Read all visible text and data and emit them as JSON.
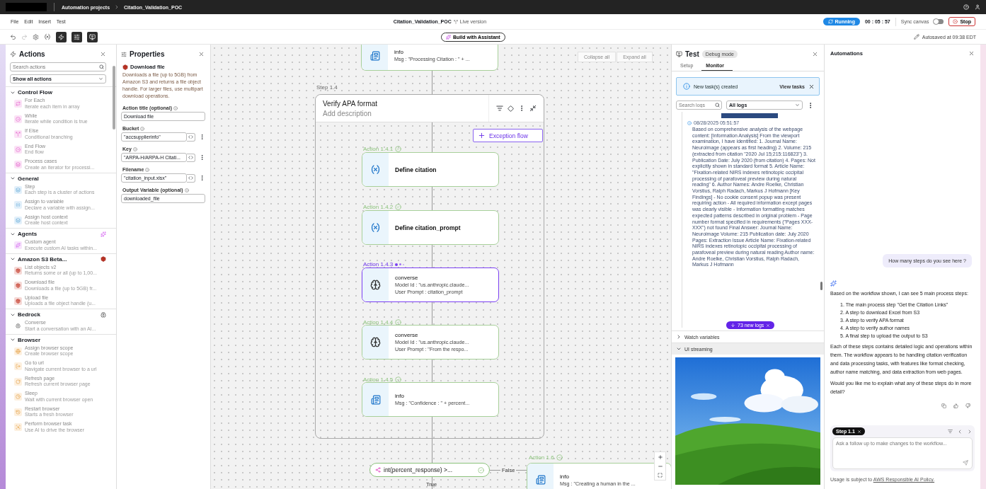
{
  "top_bar": {
    "breadcrumbs": [
      {
        "label": "Automation projects"
      },
      {
        "label": "Citation_Validation_POC"
      }
    ]
  },
  "menu": [
    "File",
    "Edit",
    "Insert",
    "Test"
  ],
  "document": {
    "title": "Citation_Validation_POC",
    "version": "Live version"
  },
  "run": {
    "status": "Running",
    "timer": "00 : 05 : 57",
    "sync_label": "Sync canvas",
    "sync_on": false,
    "stop_label": "Stop"
  },
  "toolbar": {
    "toggles": [
      {
        "kind": "actions",
        "on": true
      },
      {
        "kind": "properties",
        "on": true
      },
      {
        "kind": "test",
        "on": true
      }
    ],
    "assistant_button": "Build with Assistant",
    "autosave": "Autosaved at 09:38 EDT"
  },
  "actions_panel": {
    "title": "Actions",
    "search_placeholder": "Search actions",
    "filter": "Show all actions",
    "sections": [
      {
        "title": "Control Flow",
        "kind": "control",
        "expanded": true,
        "items": [
          {
            "title": "For Each",
            "description": "Iterate each item in array"
          },
          {
            "title": "While",
            "description": "Iterate while condition is true"
          },
          {
            "title": "If Else",
            "description": "Conditional branching"
          },
          {
            "title": "End Flow",
            "description": "End flow"
          },
          {
            "title": "Process cases",
            "description": "Create an iterator for processi..."
          }
        ]
      },
      {
        "title": "General",
        "kind": "general",
        "expanded": true,
        "items": [
          {
            "title": "Step",
            "description": "Each step is a cluster of actions"
          },
          {
            "title": "Assign to variable",
            "description": "Declare a variable with assign..."
          },
          {
            "title": "Assign host context",
            "description": "Create host context"
          }
        ]
      },
      {
        "title": "Agents",
        "kind": "agents",
        "expanded": true,
        "items": [
          {
            "title": "Custom agent",
            "description": "Execute custom AI tasks within..."
          }
        ]
      },
      {
        "title": "Amazon S3 Beta...",
        "kind": "s3",
        "expanded": true,
        "items": [
          {
            "title": "List objects v2",
            "description": "Returns some or all (up to 1,00..."
          },
          {
            "title": "Download file",
            "description": "Downloads a file (up to 5GB) fr..."
          },
          {
            "title": "Upload file",
            "description": "Uploads a file object handle (u..."
          }
        ]
      },
      {
        "title": "Bedrock",
        "kind": "bedrock",
        "expanded": true,
        "items": [
          {
            "title": "Converse",
            "description": "Start a conversation with an AI..."
          }
        ]
      },
      {
        "title": "Browser",
        "kind": "browser",
        "expanded": true,
        "items": [
          {
            "title": "Assign browser scope",
            "description": "Create browser scope"
          },
          {
            "title": "Go to url",
            "description": "Navigate current browser to a url"
          },
          {
            "title": "Refresh page",
            "description": "Refresh current browser page"
          },
          {
            "title": "Sleep",
            "description": "Wait with current browser open"
          },
          {
            "title": "Restart browser",
            "description": "Starts a fresh browser"
          },
          {
            "title": "Perform browser task",
            "description": "Use AI to drive the browser"
          }
        ]
      }
    ]
  },
  "properties_panel": {
    "title": "Properties",
    "action": {
      "name": "Download file",
      "description": "Downloads a file (up to 5GB) from Amazon S3 and returns a file object handle. For larger files, use multipart download operations."
    },
    "fields": [
      {
        "label": "Action title (optional)",
        "value": "Download file",
        "kind": "text"
      },
      {
        "label": "Bucket",
        "value": "\"accsupplierinfo\"",
        "kind": "expression"
      },
      {
        "label": "Key",
        "value": "\"ARPA-H/ARPA-H Citati...",
        "kind": "expression"
      },
      {
        "label": "Filename",
        "value": "\"citation_input.xlsx\"",
        "kind": "expression"
      },
      {
        "label": "Output Variable (optional)",
        "value": "downloaded_file",
        "kind": "text"
      }
    ]
  },
  "canvas": {
    "controls": [
      "Collapse all",
      "Expand all"
    ],
    "prev_node": {
      "kind": "log",
      "title": "info",
      "lines": [
        "Msg : \"Processing Citation : \" + ..."
      ]
    },
    "step": {
      "label": "Step 1.4",
      "title": "Verify APA format",
      "description": "Add description",
      "exception_button": "Exception flow",
      "actions": [
        {
          "label": "Action 1.4.1",
          "running": false,
          "kind": "variable",
          "title": "Define citation"
        },
        {
          "label": "Action 1.4.2",
          "running": false,
          "kind": "variable",
          "title": "Define citation_prompt"
        },
        {
          "label": "Action 1.4.3",
          "running": true,
          "kind": "model",
          "title": "converse",
          "lines": [
            "Model Id : \"us.anthropic.claude...",
            "User Prompt : citation_prompt"
          ]
        },
        {
          "label": "Action 1.4.4",
          "running": false,
          "kind": "model",
          "title": "converse",
          "lines": [
            "Model Id : \"us.anthropic.claude...",
            "User Prompt : \"From the respo..."
          ]
        },
        {
          "label": "Action 1.4.5",
          "running": false,
          "kind": "log",
          "title": "info",
          "lines": [
            "Msg : \"Confidence : \" + percent..."
          ]
        }
      ]
    },
    "condition": {
      "text": "int(percent_response) >...",
      "running": false
    },
    "branches": {
      "false": "False",
      "true": "True"
    },
    "next_action": {
      "label": "Action 1.6",
      "running": false,
      "kind": "log",
      "title": "info",
      "lines": [
        "Msg : \"Creating a human in the ..."
      ]
    }
  },
  "test_panel": {
    "title": "Test",
    "badge": "Debug mode",
    "tabs": [
      {
        "label": "Setup",
        "selected": false
      },
      {
        "label": "Monitor",
        "selected": true
      }
    ],
    "alert": {
      "text": "New task(s) created",
      "action": "View tasks"
    },
    "log_search_placeholder": "Search logs",
    "log_filter": "All logs",
    "log": {
      "time": "08/28/2025 05:51:57",
      "text": "Based on comprehensive analysis of the webpage content: [Information Analysis] From the viewport examination, I have identified: 1. Journal Name: Neuroimage (appears as first heading) 2. Volume: 215 (extracted from citation \"2020 Jul 15;215:116823\") 3. Publication Date: July 2020 (from citation) 4. Pages: Not explicitly shown in standard format 5. Article Name: \"Fixation-related NIRS indexes retinotopic occipital processing of parafoveal preview during natural reading\" 6. Author Names: Andre Roelke, Christian Vorstius, Ralph Radach, Markus J Hofmann [Key Findings] - No cookie consent popup was present requiring action - All required information except pages was clearly visible - Information formatting matches expected patterns described in original problem - Page number format specified in requirements (\"Pages XXX-XXX\") not found Final Answer: Journal Name: Neuroimage Volume: 215 Publication date: July 2020 Pages: Extraction Issue Article Name: Fixation-related NIRS indexes retinotopic occipital processing of parafoveal preview during natural reading Author name: Andre Roelke, Christian Vorstius, Ralph Radach, Markus J Hofmann"
    },
    "new_logs": "73 new logs",
    "sections": [
      {
        "label": "Watch variables",
        "expanded": false
      },
      {
        "label": "UI streaming",
        "expanded": true
      }
    ]
  },
  "automations": {
    "title": "Automations",
    "messages": [
      {
        "kind": "user",
        "blocks": [
          {
            "kind": "paragraph",
            "text": "How many steps do you see here ?"
          }
        ]
      },
      {
        "kind": "assistant",
        "blocks": [
          {
            "kind": "paragraph",
            "text": "Based on the workflow shown, I can see 5 main process steps:"
          },
          {
            "kind": "list",
            "items": [
              "1. The main process step \"Get the Citation Links\"",
              "2. A step to download Excel from S3",
              "3. A step to verify APA format",
              "4. A step to verify author names",
              "5. A final step to upload the output to S3"
            ]
          },
          {
            "kind": "paragraph",
            "text": "Each of these steps contains detailed logic and operations within them. The workflow appears to be handling citation verification and data processing tasks, with features like format checking, author name matching, and data extraction from web pages."
          },
          {
            "kind": "paragraph",
            "text": "Would you like me to explain what any of these steps do in more detail?"
          }
        ]
      }
    ],
    "composer": {
      "chip": "Step 1.1",
      "placeholder": "Ask a follow up to make changes to the workflow..."
    },
    "footer": {
      "text": "Usage is subject to",
      "link": "AWS Responsible AI Policy."
    }
  }
}
